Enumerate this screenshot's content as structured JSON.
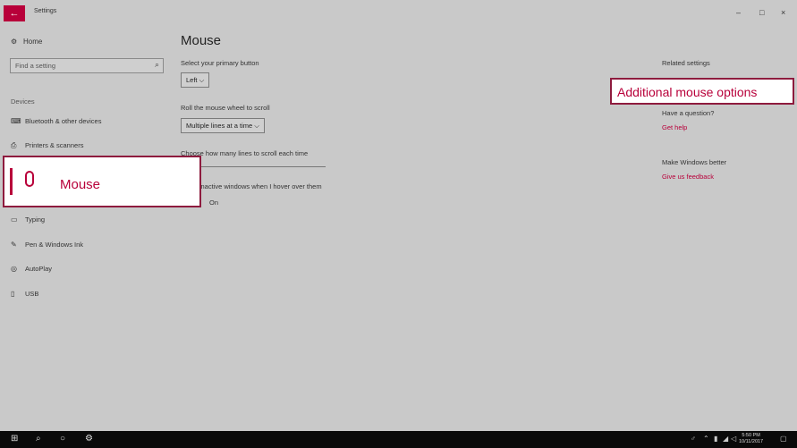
{
  "window": {
    "title": "Settings",
    "back_glyph": "←",
    "minimize": "–",
    "maximize": "□",
    "close": "×"
  },
  "sidebar": {
    "home_label": "Home",
    "search_placeholder": "Find a setting",
    "section_label": "Devices",
    "items": [
      {
        "label": "Bluetooth & other devices",
        "icon": "bluetooth-devices-icon"
      },
      {
        "label": "Printers & scanners",
        "icon": "printer-icon"
      },
      {
        "label": "Mouse",
        "icon": "mouse-icon",
        "selected": true
      },
      {
        "label": "Typing",
        "icon": "keyboard-icon"
      },
      {
        "label": "Pen & Windows Ink",
        "icon": "pen-icon"
      },
      {
        "label": "AutoPlay",
        "icon": "autoplay-icon"
      },
      {
        "label": "USB",
        "icon": "usb-icon"
      }
    ]
  },
  "main": {
    "title": "Mouse",
    "primary_button_label": "Select your primary button",
    "primary_button_value": "Left",
    "scroll_label": "Roll the mouse wheel to scroll",
    "scroll_value": "Multiple lines at a time",
    "lines_label": "Choose how many lines to scroll each time",
    "inactive_label": "Scroll inactive windows when I hover over them",
    "inactive_value": "On"
  },
  "related": {
    "heading": "Related settings",
    "additional_options": "Additional mouse options",
    "question_heading": "Have a question?",
    "get_help": "Get help",
    "better_heading": "Make Windows better",
    "feedback": "Give us feedback"
  },
  "callouts": {
    "left_label": "Mouse",
    "right_label": "Additional mouse options"
  },
  "taskbar": {
    "time": "5:50 PM",
    "date": "10/11/2017"
  },
  "colors": {
    "accent": "#b8003a",
    "background": "#c9c9c9",
    "taskbar": "#0a0a0a",
    "callout_border": "#8e1b3e"
  }
}
